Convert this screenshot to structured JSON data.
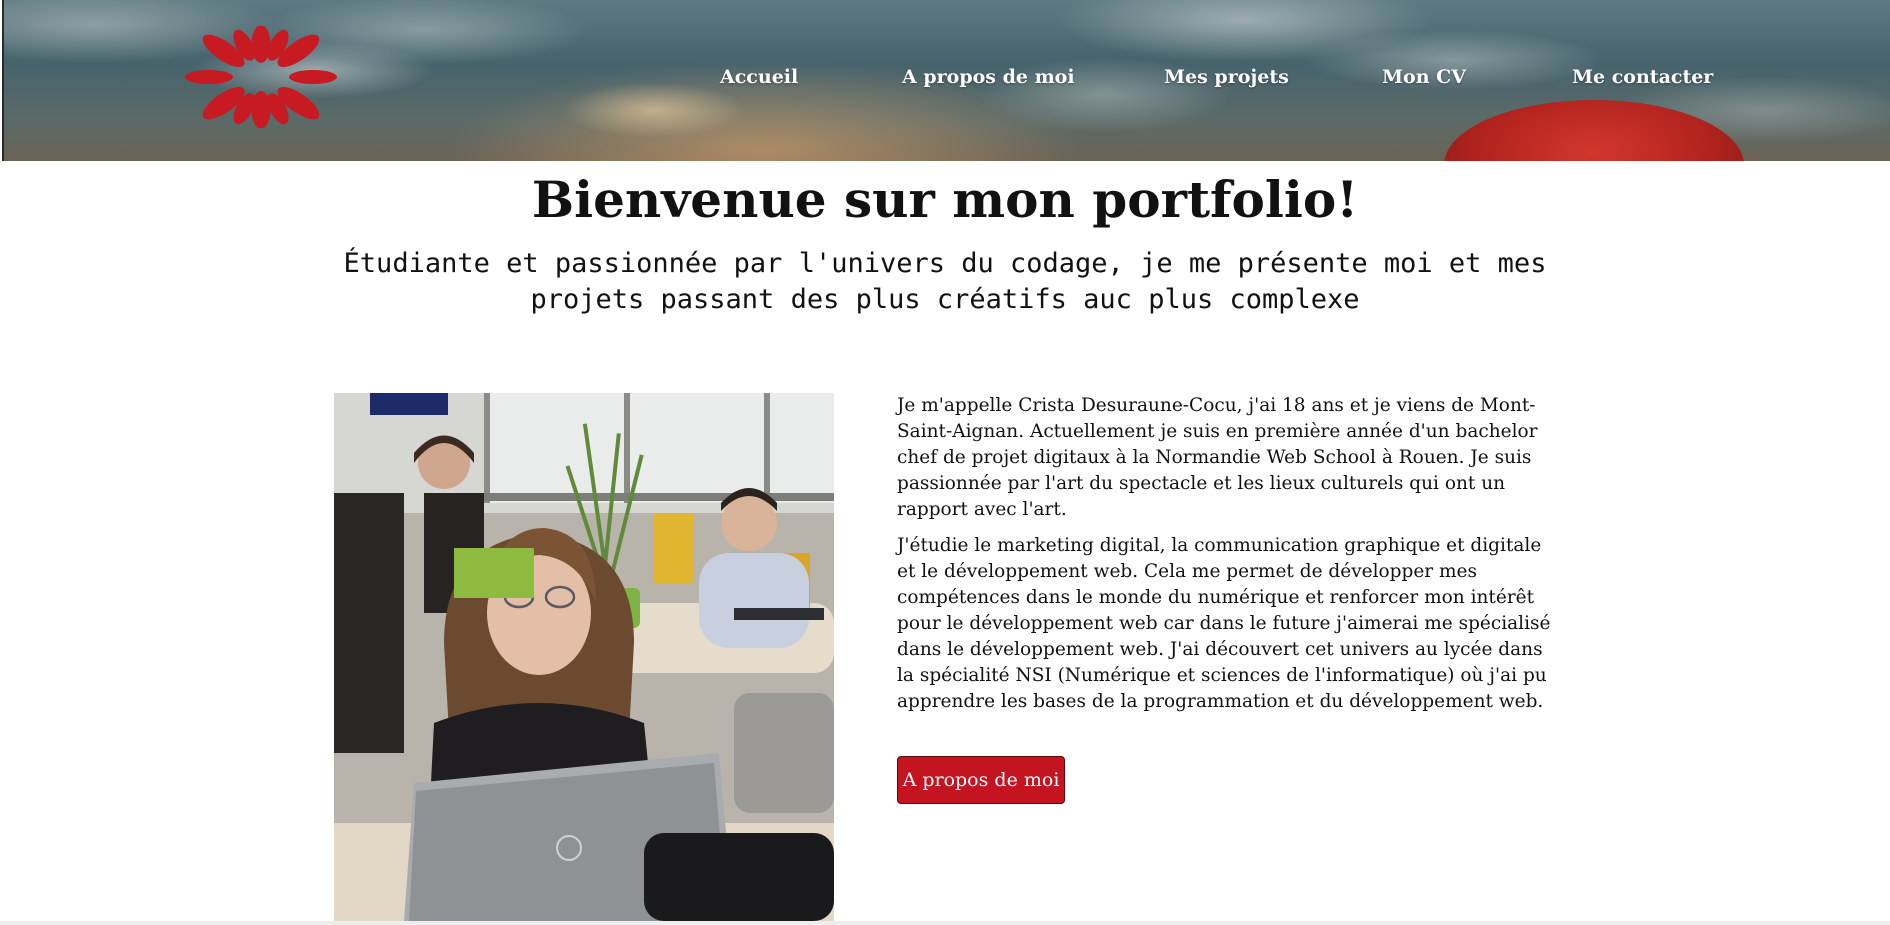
{
  "header": {
    "logo_icon": "flower-logo-icon",
    "nav": [
      {
        "label": "Accueil"
      },
      {
        "label": "A propos de moi"
      },
      {
        "label": "Mes projets"
      },
      {
        "label": "Mon CV"
      },
      {
        "label": "Me contacter"
      }
    ]
  },
  "hero": {
    "title": "Bienvenue sur mon portfolio!",
    "subtitle": "Étudiante et passionnée par l'univers du codage, je me présente moi et mes projets passant des plus créatifs auc plus complexe"
  },
  "about": {
    "paragraphs": [
      "Je m'appelle Crista Desuraune-Cocu, j'ai 18 ans et je viens de Mont-Saint-Aignan. Actuellement je suis en première année d'un bachelor chef de projet digitaux à la Normandie Web School à Rouen. Je suis passionnée par l'art du spectacle et les lieux culturels qui ont un rapport avec l'art.",
      "J'étudie le marketing digital, la communication graphique et digitale et le développement web. Cela me permet de développer mes compétences dans le monde du numérique et renforcer mon intérêt pour le développement web car dans le future j'aimerai me spécialisé dans le développement web. J'ai découvert cet univers au lycée dans la spécialité NSI (Numérique et sciences de l'informatique) où j'ai pu apprendre les bases de la programmation et du développement web."
    ],
    "button_label": "A propos de moi"
  },
  "colors": {
    "accent": "#c4141f",
    "logo": "#c81a22",
    "nav_text": "#ffffff",
    "text": "#111111"
  }
}
